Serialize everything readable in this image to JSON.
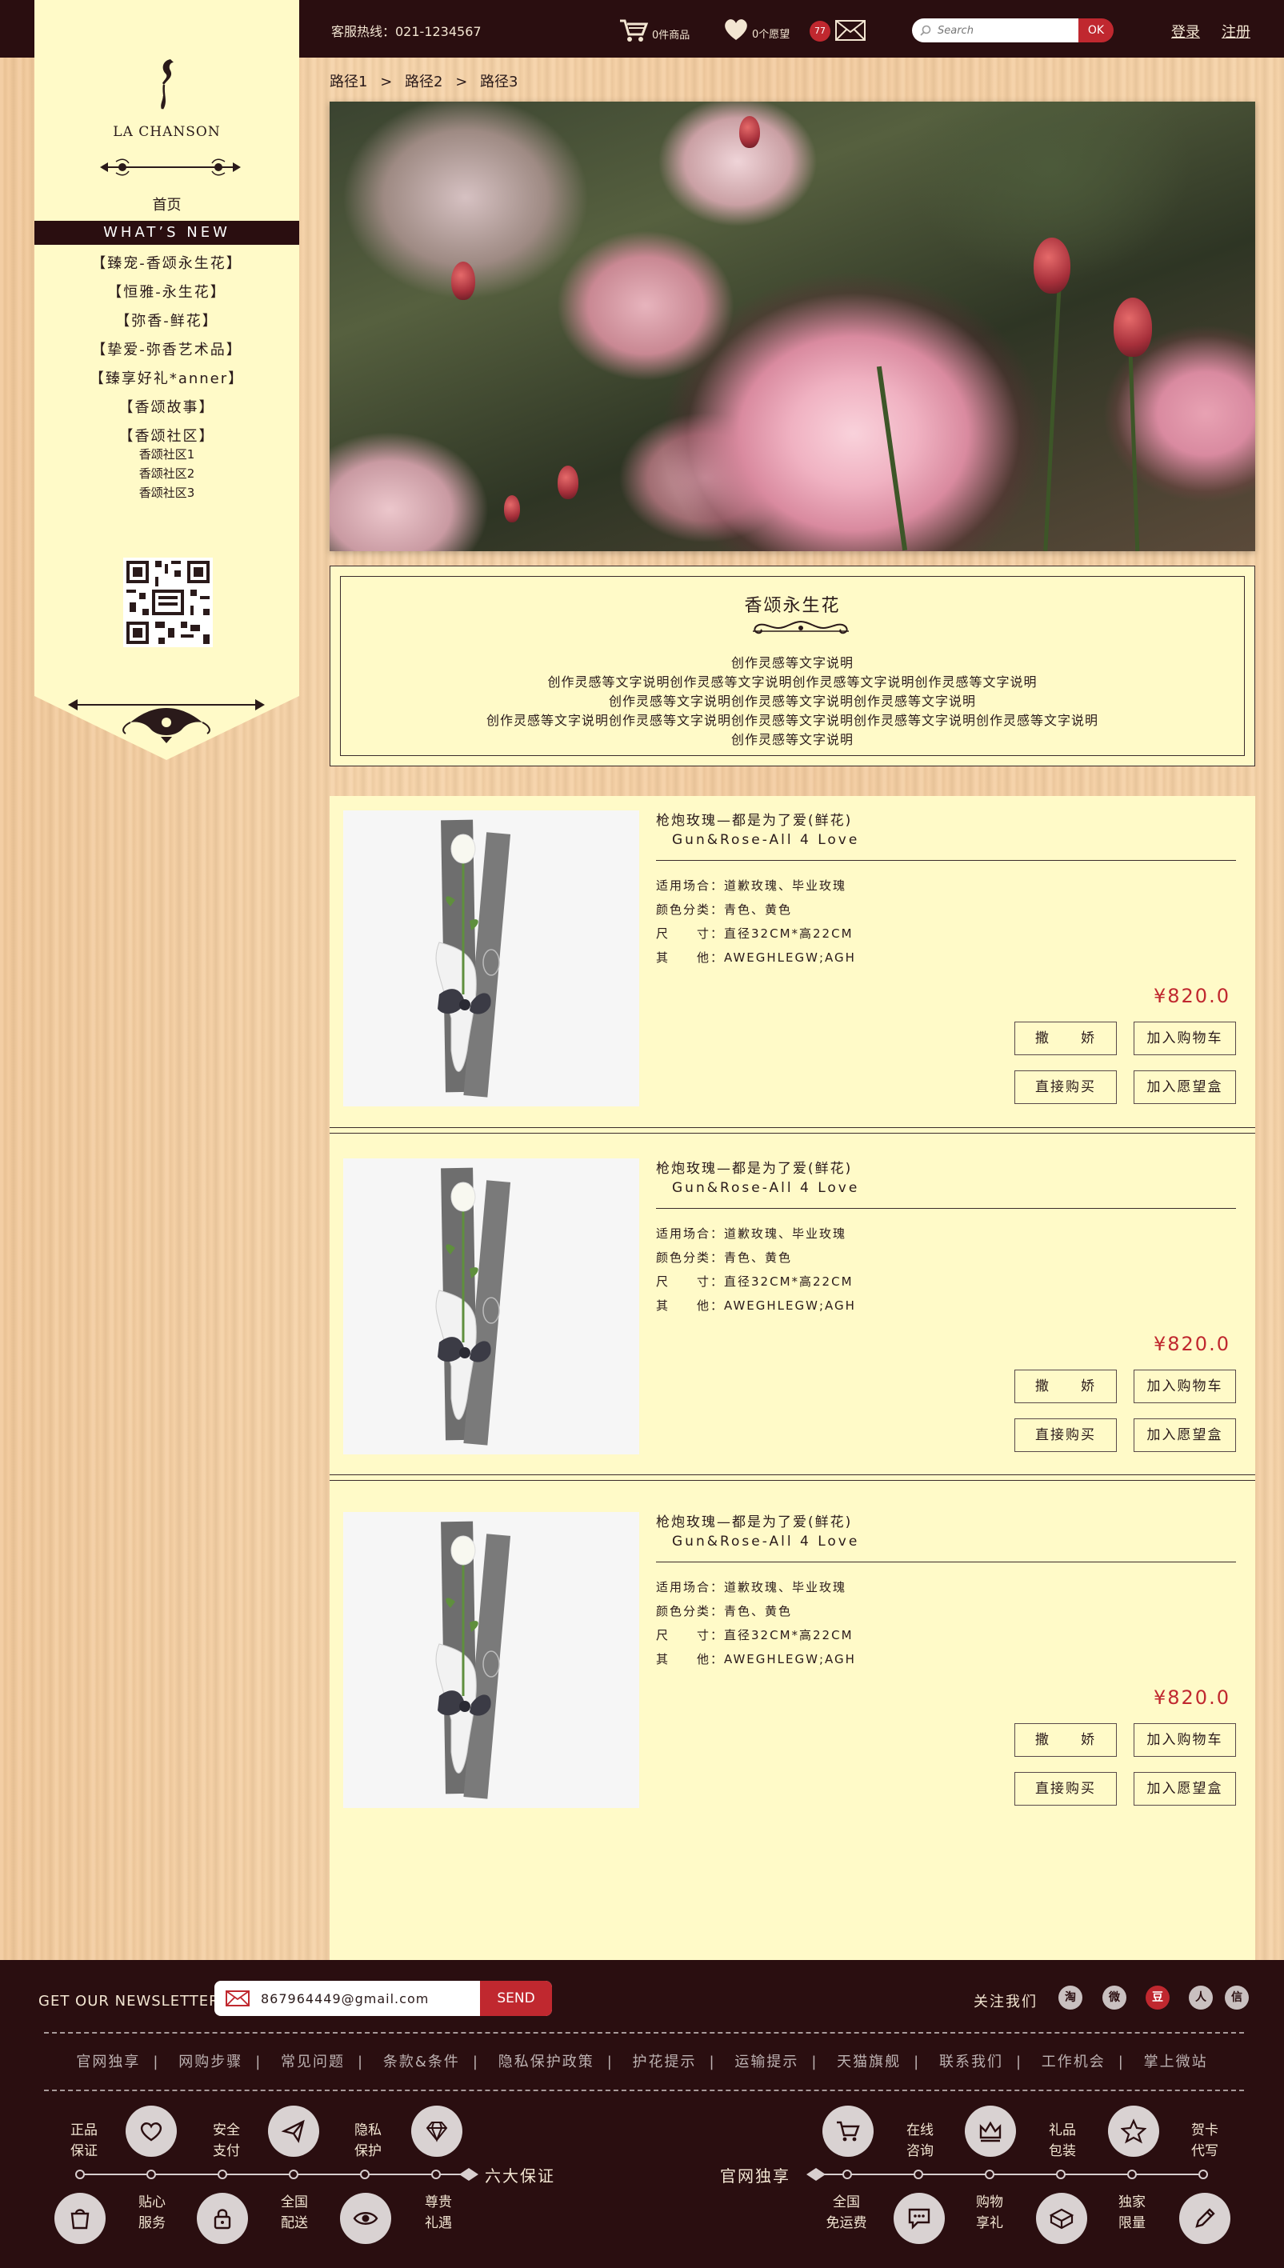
{
  "topbar": {
    "hotline": "客服热线：021-1234567",
    "cart_label": "0件商品",
    "wish_label": "0个愿望",
    "message_count": "77",
    "search_placeholder": "Search",
    "search_button": "OK",
    "login": "登录",
    "register": "注册"
  },
  "sidebar": {
    "brand": "LA CHANSON",
    "home": "首页",
    "whats_new": "WHAT’S NEW",
    "items": [
      "【臻宠-香颂永生花】",
      "【恒雅-永生花】",
      "【弥香-鲜花】",
      "【挚爱-弥香艺术品】",
      "【臻享好礼*anner】",
      "【香颂故事】",
      "【香颂社区】"
    ],
    "sub_items": [
      "香颂社区1",
      "香颂社区2",
      "香颂社区3"
    ]
  },
  "breadcrumb": [
    "路径1",
    "路径2",
    "路径3"
  ],
  "breadcrumb_sep": ">",
  "intro": {
    "title": "香颂永生花",
    "lines": [
      "创作灵感等文字说明",
      "创作灵感等文字说明创作灵感等文字说明创作灵感等文字说明创作灵感等文字说明",
      "创作灵感等文字说明创作灵感等文字说明创作灵感等文字说明",
      "创作灵感等文字说明创作灵感等文字说明创作灵感等文字说明创作灵感等文字说明创作灵感等文字说明",
      "创作灵感等文字说明"
    ]
  },
  "products": [
    {
      "name": "枪炮玫瑰—都是为了爱(鲜花)",
      "name_en": "Gun&Rose-All 4 Love",
      "occasion": "适用场合：道歉玫瑰、毕业玫瑰",
      "color": "颜色分类：青色、黄色",
      "size_label": "尺　　寸：",
      "size": "直径32CM*高22CM",
      "other_label": "其　　他：",
      "other": "AWEGHLEGW;AGH",
      "price": "¥820.0",
      "btn_spoil": "撒　　娇",
      "btn_cart": "加入购物车",
      "btn_buy": "直接购买",
      "btn_wish": "加入愿望盒"
    },
    {
      "name": "枪炮玫瑰—都是为了爱(鲜花)",
      "name_en": "Gun&Rose-All 4 Love",
      "occasion": "适用场合：道歉玫瑰、毕业玫瑰",
      "color": "颜色分类：青色、黄色",
      "size_label": "尺　　寸：",
      "size": "直径32CM*高22CM",
      "other_label": "其　　他：",
      "other": "AWEGHLEGW;AGH",
      "price": "¥820.0",
      "btn_spoil": "撒　　娇",
      "btn_cart": "加入购物车",
      "btn_buy": "直接购买",
      "btn_wish": "加入愿望盒"
    },
    {
      "name": "枪炮玫瑰—都是为了爱(鲜花)",
      "name_en": "Gun&Rose-All 4 Love",
      "occasion": "适用场合：道歉玫瑰、毕业玫瑰",
      "color": "颜色分类：青色、黄色",
      "size_label": "尺　　寸：",
      "size": "直径32CM*高22CM",
      "other_label": "其　　他：",
      "other": "AWEGHLEGW;AGH",
      "price": "¥820.0",
      "btn_spoil": "撒　　娇",
      "btn_cart": "加入购物车",
      "btn_buy": "直接购买",
      "btn_wish": "加入愿望盒"
    }
  ],
  "footer": {
    "newsletter_label": "GET OUR NEWSLETTER",
    "newsletter_value": "867964449@gmail.com",
    "send": "SEND",
    "follow": "关注我们",
    "social_icons": [
      "taobao-icon",
      "weibo-icon",
      "douban-icon",
      "renren-icon",
      "wechat-icon"
    ],
    "social_glyphs": [
      "淘",
      "微",
      "豆",
      "人",
      "信"
    ],
    "links": [
      "官网独享",
      "网购步骤",
      "常见问题",
      "条款&条件",
      "隐私保护政策",
      "护花提示",
      "运输提示",
      "天猫旗舰",
      "联系我们",
      "工作机会",
      "掌上微站"
    ],
    "six_guarantee": "六大保证",
    "exclusive": "官网独享",
    "left_top": [
      "正品\n保证",
      "安全\n支付",
      "隐私\n保护"
    ],
    "left_bottom": [
      "贴心\n服务",
      "全国\n配送",
      "尊贵\n礼遇"
    ],
    "right_top": [
      "在线\n咨询",
      "礼品\n包装",
      "贺卡\n代写"
    ],
    "right_bottom": [
      "全国\n免运费",
      "购物\n享礼",
      "独家\n限量"
    ]
  },
  "colors": {
    "accent": "#c0282f",
    "dark": "#2a0e10",
    "panel": "#fffac8"
  }
}
